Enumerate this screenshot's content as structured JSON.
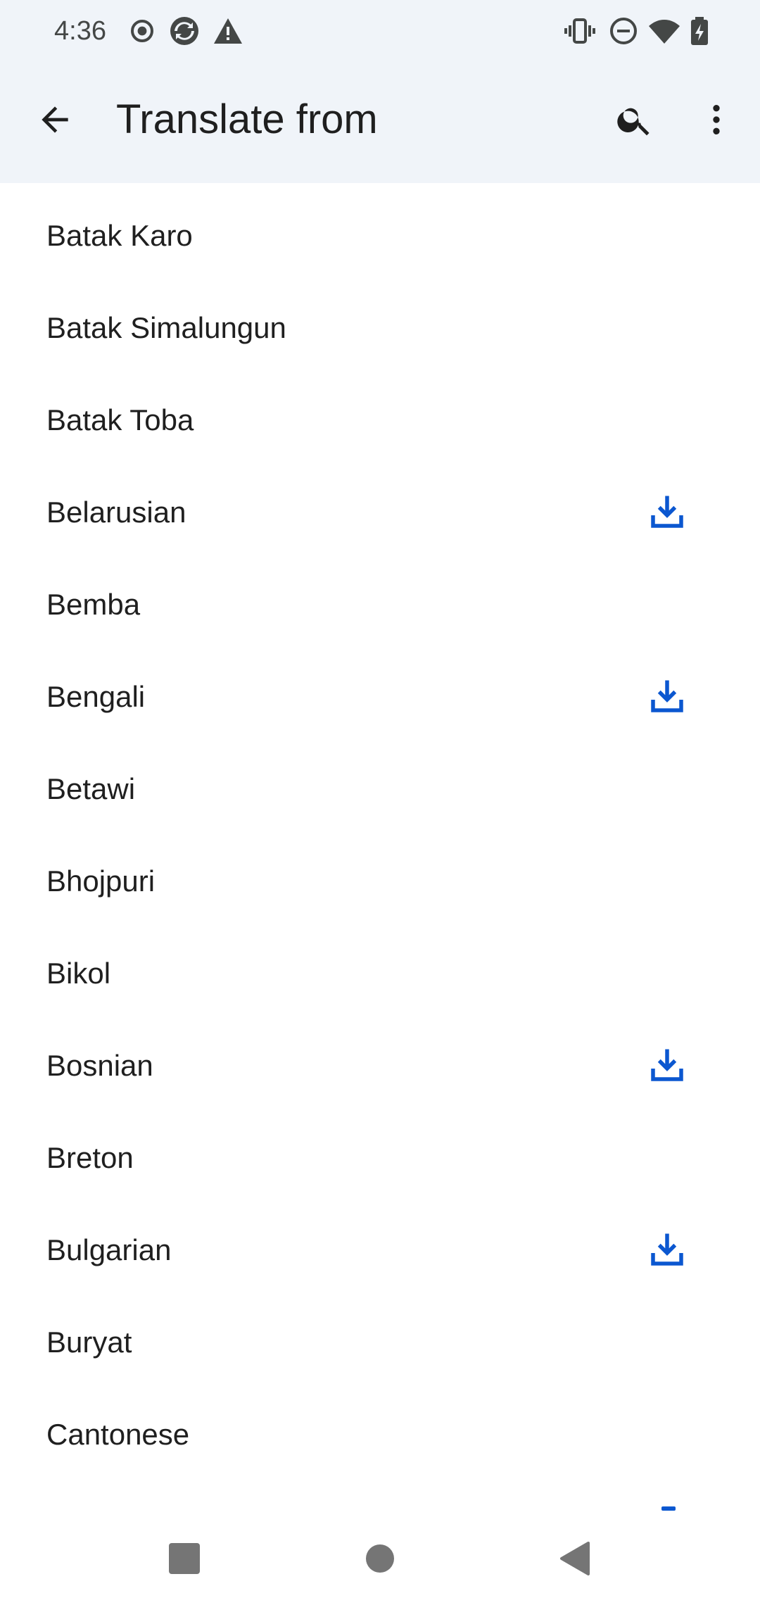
{
  "status_bar": {
    "time": "4:36",
    "left_icons": [
      "record-icon",
      "sync-icon",
      "warning-icon"
    ],
    "right_icons": [
      "vibrate-icon",
      "do-not-disturb-icon",
      "wifi-icon",
      "battery-charging-icon"
    ]
  },
  "app_bar": {
    "title": "Translate from",
    "back_icon": "arrow-back-icon",
    "search_icon": "search-icon",
    "more_icon": "more-vert-icon"
  },
  "languages": [
    {
      "label": "Batak Karo",
      "downloadable": false
    },
    {
      "label": "Batak Simalungun",
      "downloadable": false
    },
    {
      "label": "Batak Toba",
      "downloadable": false
    },
    {
      "label": "Belarusian",
      "downloadable": true
    },
    {
      "label": "Bemba",
      "downloadable": false
    },
    {
      "label": "Bengali",
      "downloadable": true
    },
    {
      "label": "Betawi",
      "downloadable": false
    },
    {
      "label": "Bhojpuri",
      "downloadable": false
    },
    {
      "label": "Bikol",
      "downloadable": false
    },
    {
      "label": "Bosnian",
      "downloadable": true
    },
    {
      "label": "Breton",
      "downloadable": false
    },
    {
      "label": "Bulgarian",
      "downloadable": true
    },
    {
      "label": "Buryat",
      "downloadable": false
    },
    {
      "label": "Cantonese",
      "downloadable": false
    }
  ],
  "colors": {
    "app_bar_bg": "#f0f4f9",
    "accent": "#0b57d0",
    "text": "#1f1f1f"
  },
  "nav_bar": {
    "buttons": [
      "recents-button",
      "home-button",
      "back-button"
    ]
  }
}
